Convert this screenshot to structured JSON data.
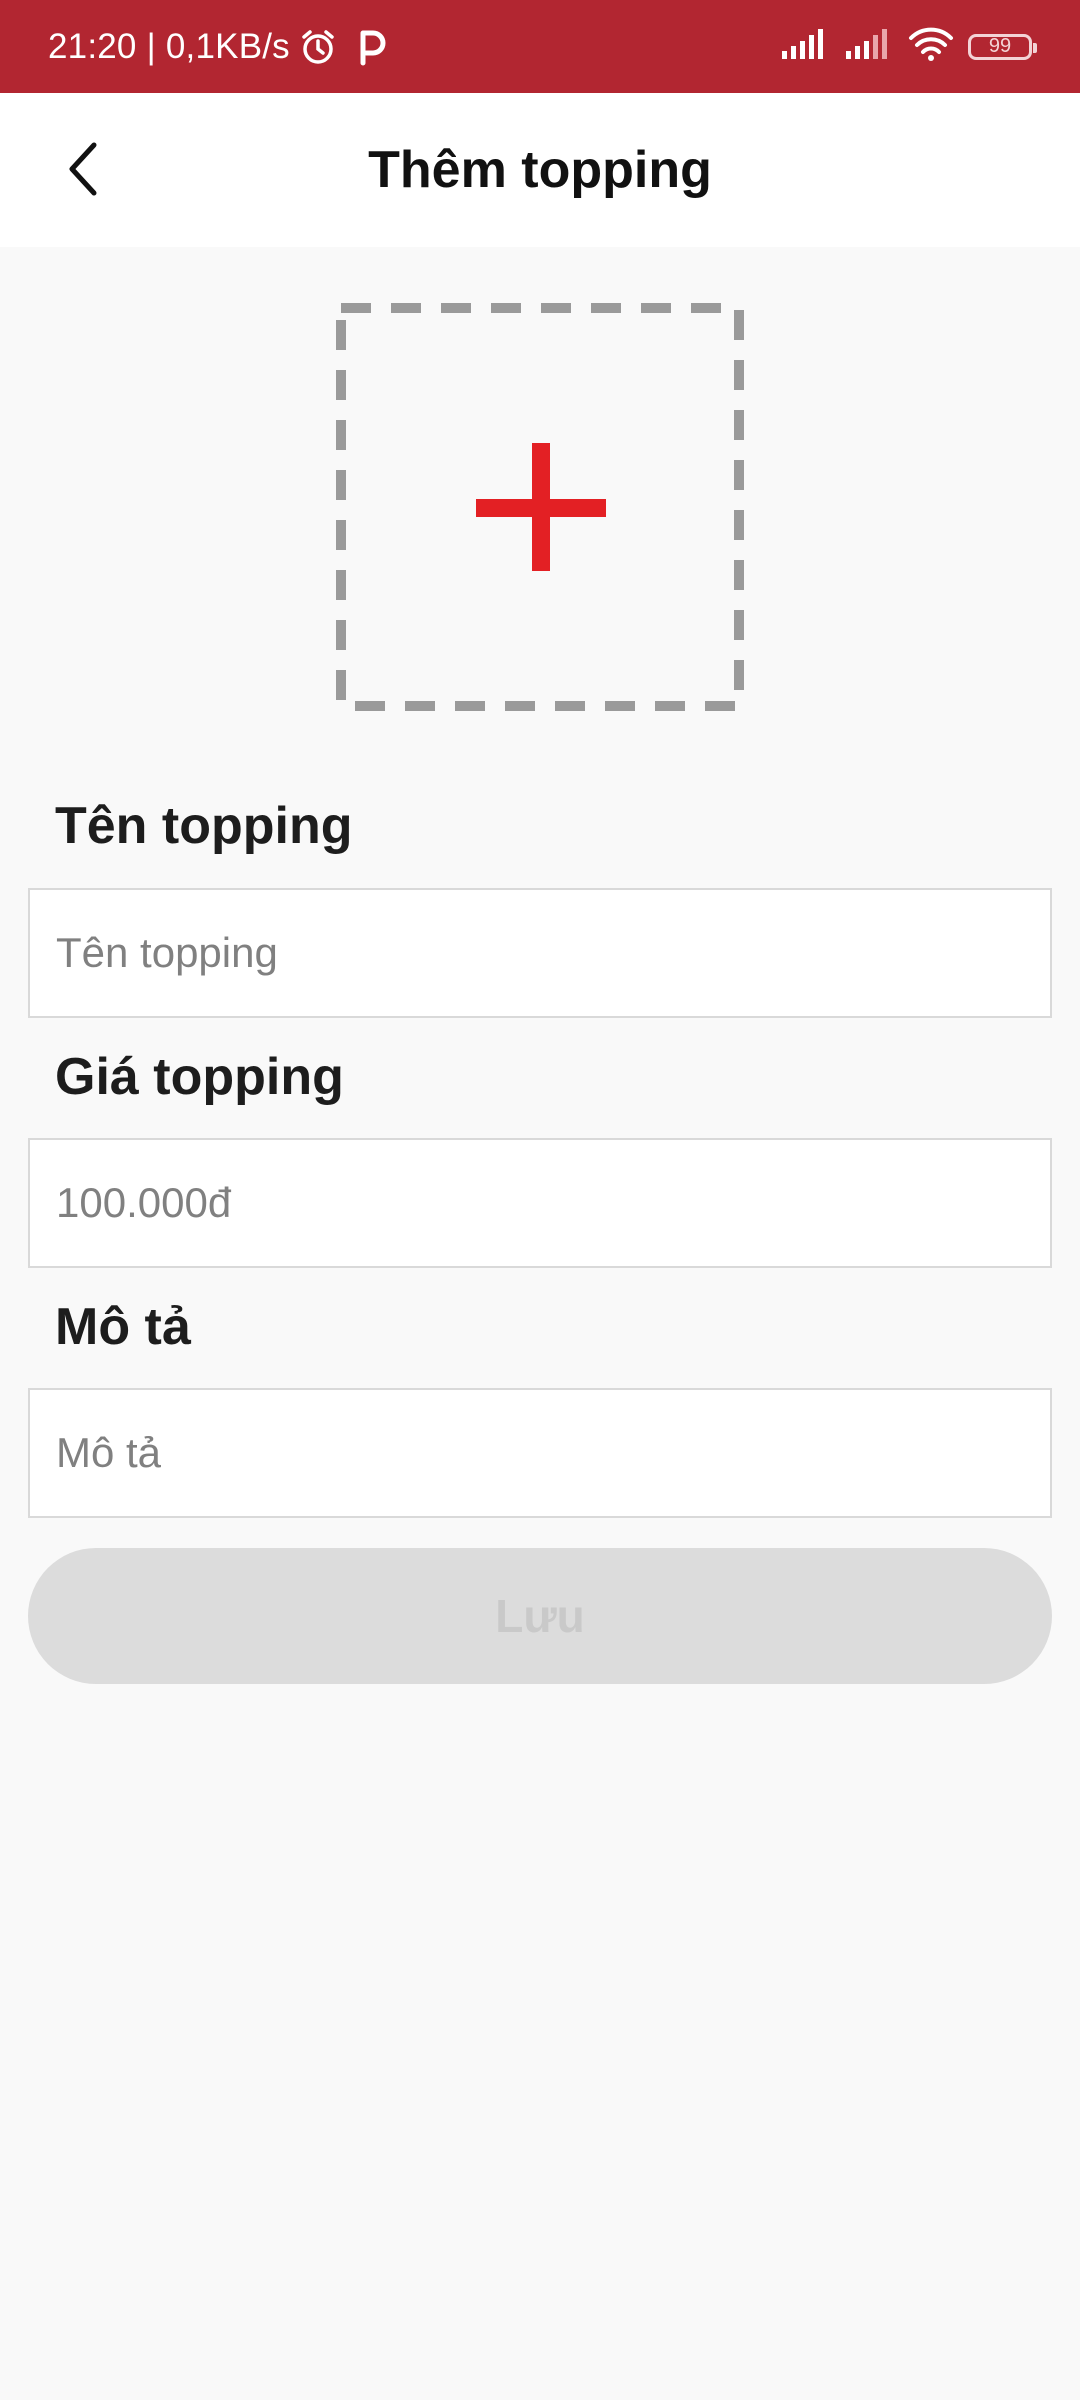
{
  "status_bar": {
    "time": "21:20",
    "separator": "|",
    "speed": "0,1KB/s",
    "battery": "99",
    "icons": [
      "alarm-icon",
      "p-icon",
      "signal-icon",
      "signal-icon",
      "wifi-icon",
      "battery-icon"
    ],
    "background": "#b22631"
  },
  "header": {
    "title": "Thêm topping",
    "back_icon": "chevron-left-icon"
  },
  "image_picker": {
    "icon": "plus-icon",
    "accent": "#e32024"
  },
  "form": {
    "name": {
      "label": "Tên topping",
      "placeholder": "Tên topping",
      "value": ""
    },
    "price": {
      "label": "Giá topping",
      "placeholder": "100.000đ",
      "value": ""
    },
    "description": {
      "label": "Mô tả",
      "placeholder": "Mô tả",
      "value": ""
    }
  },
  "save_button": {
    "label": "Lưu",
    "enabled": false
  }
}
